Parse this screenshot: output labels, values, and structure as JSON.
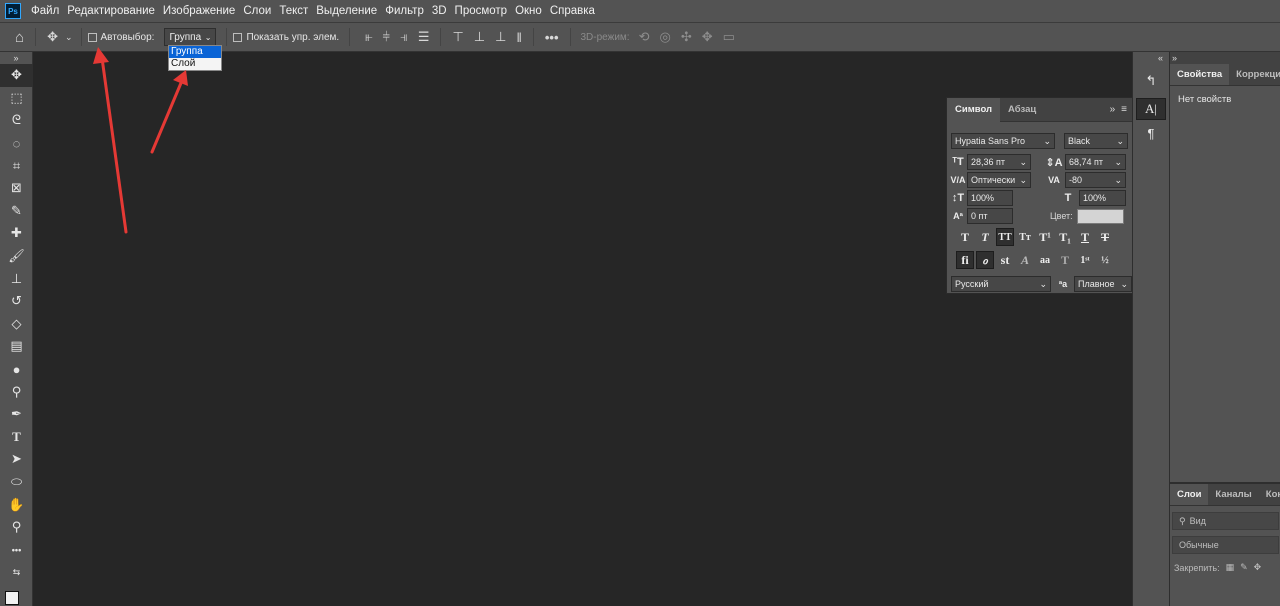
{
  "app": {
    "logo_text": "Ps"
  },
  "menu": [
    "Файл",
    "Редактирование",
    "Изображение",
    "Слои",
    "Текст",
    "Выделение",
    "Фильтр",
    "3D",
    "Просмотр",
    "Окно",
    "Справка"
  ],
  "options": {
    "autoselect_label": "Автовыбор:",
    "autoselect_value": "Группа",
    "show_transform_label": "Показать упр. элем.",
    "mode_3d_label": "3D-режим:",
    "dropdown_options": [
      "Группа",
      "Слой"
    ],
    "dropdown_selected": "Группа"
  },
  "character_panel": {
    "tabs": [
      "Символ",
      "Абзац"
    ],
    "font_family": "Hypatia Sans Pro",
    "font_style": "Black",
    "font_size": "28,36 пт",
    "leading": "68,74 пт",
    "kerning": "Оптически",
    "tracking": "-80",
    "vertical_scale": "100%",
    "horizontal_scale": "100%",
    "baseline_shift": "0 пт",
    "color_label": "Цвет:",
    "color_value": "#d4d4d4",
    "language": "Русский",
    "antialias": "Плавное"
  },
  "properties_panel": {
    "tabs": [
      "Свойства",
      "Коррекция"
    ],
    "empty_text": "Нет свойств"
  },
  "layers_panel": {
    "tabs": [
      "Слои",
      "Каналы",
      "Кон"
    ],
    "search_placeholder": "Вид",
    "blend_mode": "Обычные",
    "lock_label": "Закрепить:"
  },
  "annotation": {
    "arrow_color": "#e53935"
  }
}
